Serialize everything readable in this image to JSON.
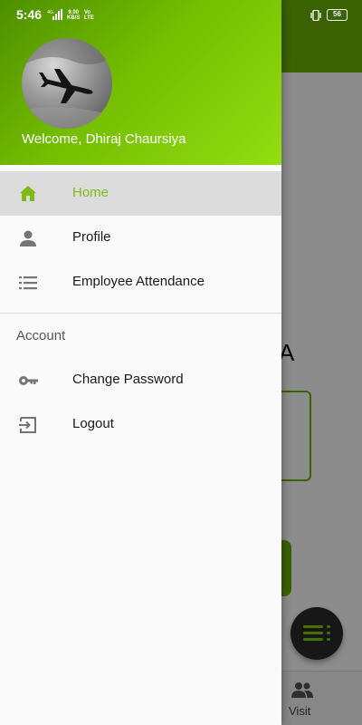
{
  "status_bar": {
    "time": "5:46",
    "network": "4G",
    "speed_value": "9.00",
    "speed_unit": "KB/S",
    "volte_top": "Vo",
    "volte_bottom": "LTE",
    "battery": "56"
  },
  "drawer": {
    "welcome_text": "Welcome, Dhiraj Chaursiya",
    "avatar_icon": "airplane-icon",
    "items": [
      {
        "label": "Home",
        "icon": "home-icon",
        "active": true
      },
      {
        "label": "Profile",
        "icon": "person-icon",
        "active": false
      },
      {
        "label": "Employee Attendance",
        "icon": "list-icon",
        "active": false
      }
    ],
    "section_title": "Account",
    "account_items": [
      {
        "label": "Change Password",
        "icon": "key-icon"
      },
      {
        "label": "Logout",
        "icon": "logout-icon"
      }
    ]
  },
  "background": {
    "partial_heading": "A",
    "bottom_nav_label": "Visit"
  },
  "colors": {
    "accent": "#7dbb16",
    "header_green": "#74bd00",
    "active_bg": "#dcdcdc"
  }
}
